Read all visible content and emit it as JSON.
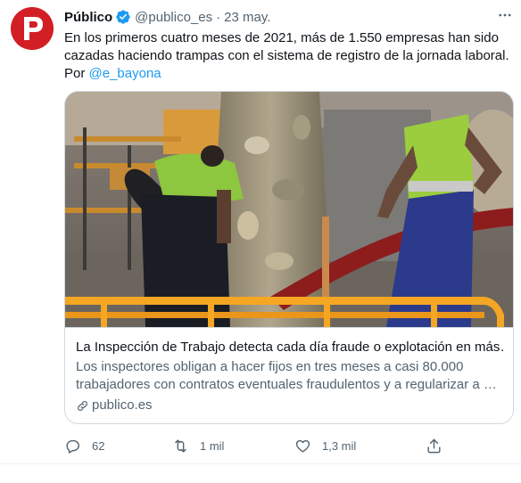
{
  "tweet": {
    "author_name": "Público",
    "author_handle": "@publico_es",
    "separator": "·",
    "date": "23 may.",
    "text_line1": "En los primeros cuatro meses de 2021, más de 1.550 empresas han sido",
    "text_line2": "cazadas haciendo trampas con el sistema de registro de la jornada laboral.",
    "text_prefix": "Por ",
    "mention": "@e_bayona"
  },
  "card": {
    "title": "La Inspección de Trabajo detecta cada día fraude o explotación en más…",
    "description_line1": "Los inspectores obligan a hacer fijos en tres meses a casi 80.000",
    "description_line2": "trabajadores con contratos eventuales fraudulentos y a regularizar a …",
    "domain": "publico.es"
  },
  "actions": {
    "reply_count": "62",
    "retweet_count": "1 mil",
    "like_count": "1,3 mil"
  },
  "colors": {
    "brand": "#d21f25",
    "verified": "#1d9bf0",
    "link": "#1d9bf0",
    "muted": "#536471"
  },
  "icons": [
    "publico-logo-icon",
    "verified-badge-icon",
    "more-icon",
    "link-icon",
    "reply-icon",
    "retweet-icon",
    "like-icon",
    "share-icon"
  ]
}
